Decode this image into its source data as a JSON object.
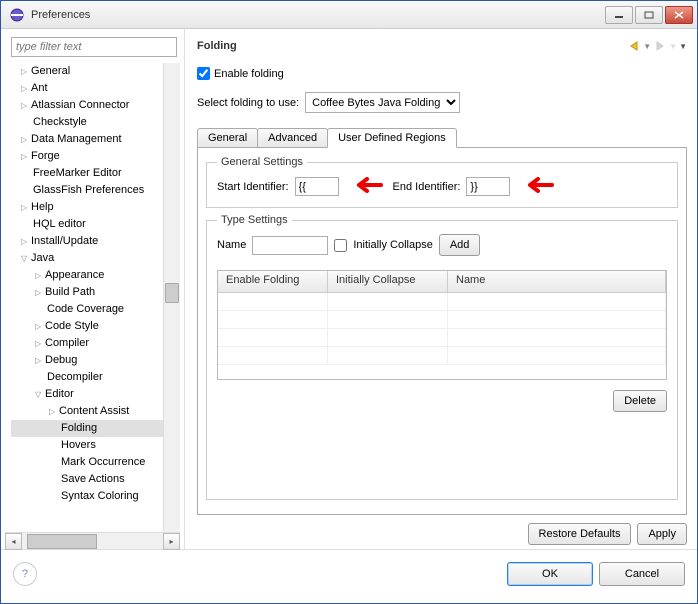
{
  "title": "Preferences",
  "filter_placeholder": "type filter text",
  "tree": {
    "items": [
      {
        "label": "General",
        "lv": 0,
        "exp": "expander"
      },
      {
        "label": "Ant",
        "lv": 0,
        "exp": "expander"
      },
      {
        "label": "Atlassian Connector",
        "lv": 0,
        "exp": "expander"
      },
      {
        "label": "Checkstyle",
        "lv": 0
      },
      {
        "label": "Data Management",
        "lv": 0,
        "exp": "expander"
      },
      {
        "label": "Forge",
        "lv": 0,
        "exp": "expander"
      },
      {
        "label": "FreeMarker Editor",
        "lv": 0
      },
      {
        "label": "GlassFish Preferences",
        "lv": 0
      },
      {
        "label": "Help",
        "lv": 0,
        "exp": "expander"
      },
      {
        "label": "HQL editor",
        "lv": 0
      },
      {
        "label": "Install/Update",
        "lv": 0,
        "exp": "expander"
      },
      {
        "label": "Java",
        "lv": 0,
        "exp": "expanded"
      },
      {
        "label": "Appearance",
        "lv": 1,
        "exp": "expander"
      },
      {
        "label": "Build Path",
        "lv": 1,
        "exp": "expander"
      },
      {
        "label": "Code Coverage",
        "lv": 1
      },
      {
        "label": "Code Style",
        "lv": 1,
        "exp": "expander"
      },
      {
        "label": "Compiler",
        "lv": 1,
        "exp": "expander"
      },
      {
        "label": "Debug",
        "lv": 1,
        "exp": "expander"
      },
      {
        "label": "Decompiler",
        "lv": 1
      },
      {
        "label": "Editor",
        "lv": 1,
        "exp": "expanded"
      },
      {
        "label": "Content Assist",
        "lv": 2,
        "exp": "expander"
      },
      {
        "label": "Folding",
        "lv": 2,
        "sel": true
      },
      {
        "label": "Hovers",
        "lv": 2
      },
      {
        "label": "Mark Occurrence",
        "lv": 2
      },
      {
        "label": "Save Actions",
        "lv": 2
      },
      {
        "label": "Syntax Coloring",
        "lv": 2
      }
    ]
  },
  "page": {
    "heading": "Folding",
    "enable_label": "Enable folding",
    "enable_checked": true,
    "select_label": "Select folding to use:",
    "select_value": "Coffee Bytes Java Folding",
    "tabs": [
      "General",
      "Advanced",
      "User Defined Regions"
    ],
    "active_tab": 2,
    "general_settings": {
      "legend": "General Settings",
      "start_label": "Start Identifier:",
      "start_value": "{{",
      "end_label": "End Identifier:",
      "end_value": "}}"
    },
    "type_settings": {
      "legend": "Type Settings",
      "name_label": "Name",
      "name_value": "",
      "initially_label": "Initially Collapse",
      "add_label": "Add",
      "grid_cols": [
        "Enable Folding",
        "Initially Collapse",
        "Name"
      ],
      "delete_label": "Delete"
    },
    "restore_label": "Restore Defaults",
    "apply_label": "Apply"
  },
  "footer": {
    "ok": "OK",
    "cancel": "Cancel"
  }
}
